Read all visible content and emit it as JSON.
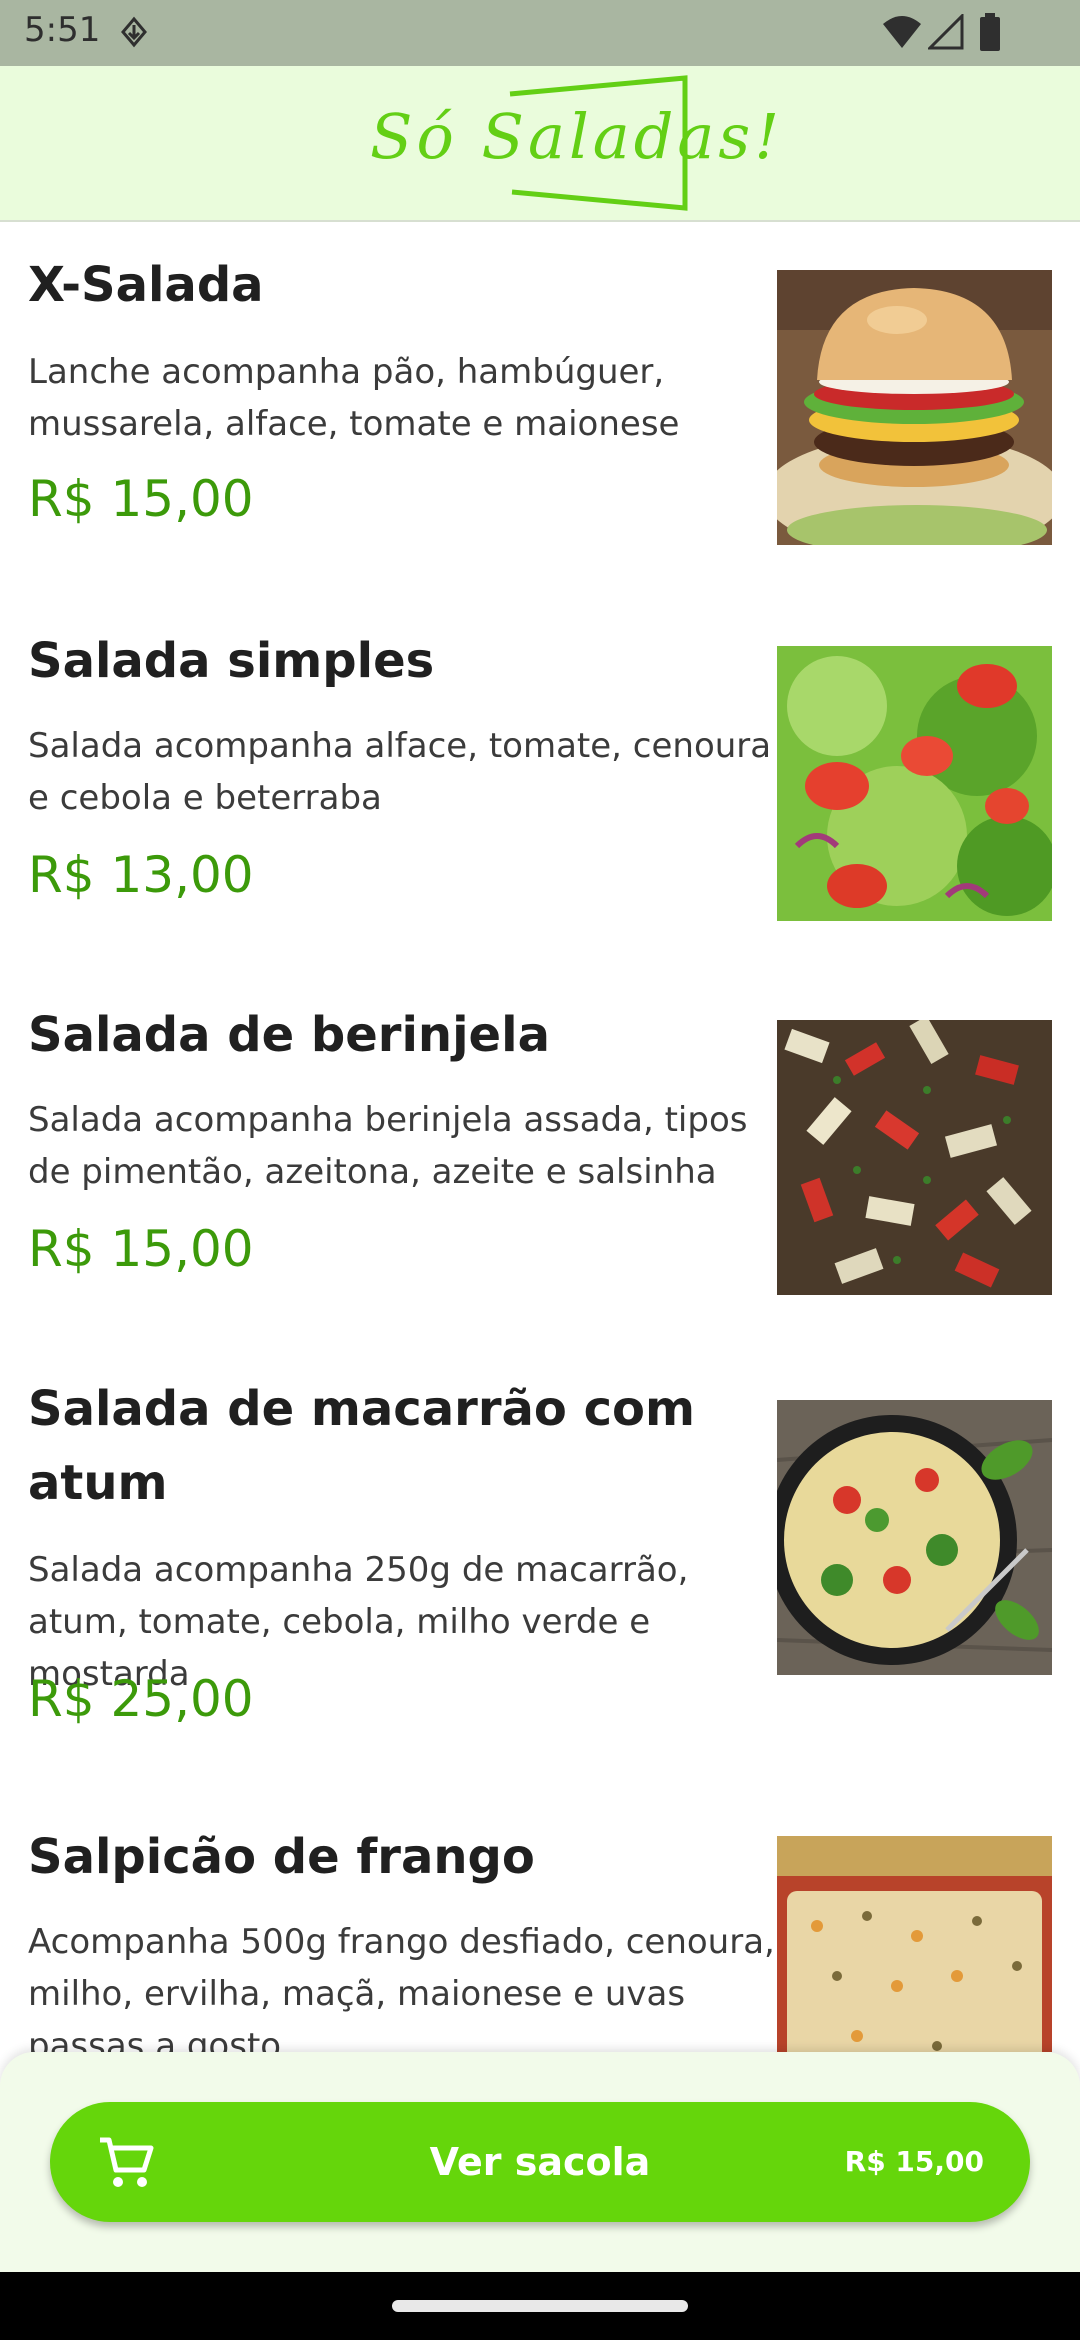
{
  "status_bar": {
    "time": "5:51"
  },
  "header": {
    "logo_text": "Só Saladas!",
    "logo_color": "#63cf15"
  },
  "menu": {
    "items": [
      {
        "title": "X-Salada",
        "description": "Lanche acompanha pão, hambúguer, mussarela, alface, tomate e maionese",
        "price": "R$ 15,00",
        "image": "burger-photo"
      },
      {
        "title": "Salada simples",
        "description": "Salada acompanha alface, tomate, cenoura e cebola e beterraba",
        "price": "R$ 13,00",
        "image": "green-salad-photo"
      },
      {
        "title": "Salada de berinjela",
        "description": "Salada acompanha berinjela assada, tipos de pimentão, azeitona, azeite e salsinha",
        "price": "R$ 15,00",
        "image": "eggplant-salad-photo"
      },
      {
        "title": "Salada de macarrão com atum",
        "description": "Salada acompanha 250g de macarrão, atum, tomate, cebola, milho verde e mostarda",
        "price": "R$ 25,00",
        "image": "pasta-salad-photo"
      },
      {
        "title": "Salpicão de frango",
        "description": "Acompanha 500g frango desfiado, cenoura, milho, ervilha, maçã, maionese e uvas passas a gosto",
        "price": "",
        "image": "chicken-salpicao-photo"
      }
    ]
  },
  "cart": {
    "label": "Ver sacola",
    "total": "R$ 15,00",
    "icon": "cart-icon",
    "accent": "#65d60b"
  },
  "colors": {
    "price": "#3c9a0a",
    "header_bg": "#eafcdc",
    "status_bg": "#a9b6a1"
  }
}
